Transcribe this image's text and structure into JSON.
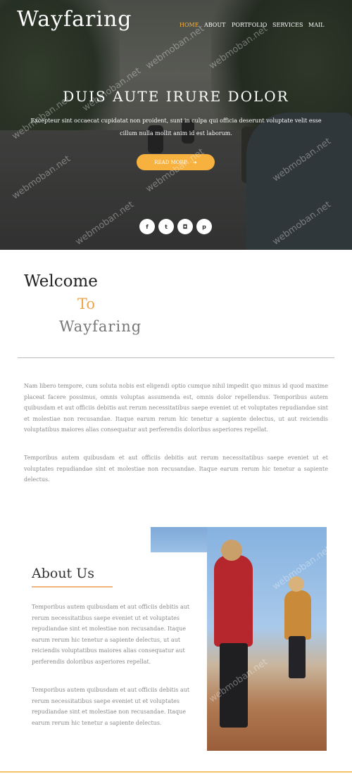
{
  "header": {
    "logo": "Wayfaring",
    "nav": [
      "HOME",
      "ABOUT",
      "PORTFOLIO",
      "SERVICES",
      "MAIL"
    ],
    "active_nav": "HOME",
    "accent": "#f7b13f"
  },
  "hero": {
    "title": "DUIS AUTE IRURE DOLOR",
    "text": "Excepteur sint occaecat cupidatat non proident, sunt in culpa qui officia deserunt voluptate velit esse cillum nulla mollit anim id est laborum.",
    "button_label": "READ MORE",
    "button_icon": "arrow-right-icon",
    "social": [
      {
        "name": "facebook-icon",
        "glyph": "f"
      },
      {
        "name": "twitter-icon",
        "glyph": "t"
      },
      {
        "name": "instagram-icon",
        "glyph": "◘"
      },
      {
        "name": "pinterest-icon",
        "glyph": "p"
      }
    ]
  },
  "welcome": {
    "line1": "Welcome",
    "line2": "To",
    "line3": "Wayfaring",
    "para1": "Nam libero tempore, cum soluta nobis est eligendi optio cumque nihil impedit quo minus id quod maxime placeat facere possimus, omnis voluptas assumenda est, omnis dolor repellendus. Temporibus autem quibusdam et aut officiis debitis aut rerum necessitatibus saepe eveniet ut et voluptates repudiandae sint et molestiae non recusandae. Itaque earum rerum hic tenetur a sapiente delectus, ut aut reiciendis voluptatibus maiores alias consequatur aut perferendis doloribus asperiores repellat.",
    "para2": "Temporibus autem quibusdam et aut officiis debitis aut rerum necessitatibus saepe eveniet ut et voluptates repudiandae sint et molestiae non recusandae. Itaque earum rerum hic tenetur a sapiente delectus."
  },
  "about": {
    "title": "About Us",
    "para1": "Temporibus autem quibusdam et aut officiis debitis aut rerum necessitatibus saepe eveniet ut et voluptates repudiandae sint et molestiae non recusandae. Itaque earum rerum hic tenetur a sapiente delectus, ut aut reiciendis voluptatibus maiores alias consequatur aut perferendis doloribus asperiores repellat.",
    "para2": "Temporibus autem quibusdam et aut officiis debitis aut rerum necessitatibus saepe eveniet ut et voluptates repudiandae sint et molestiae non recusandae. Itaque earum rerum hic tenetur a sapiente delectus."
  },
  "watermark": "webmoban.net"
}
